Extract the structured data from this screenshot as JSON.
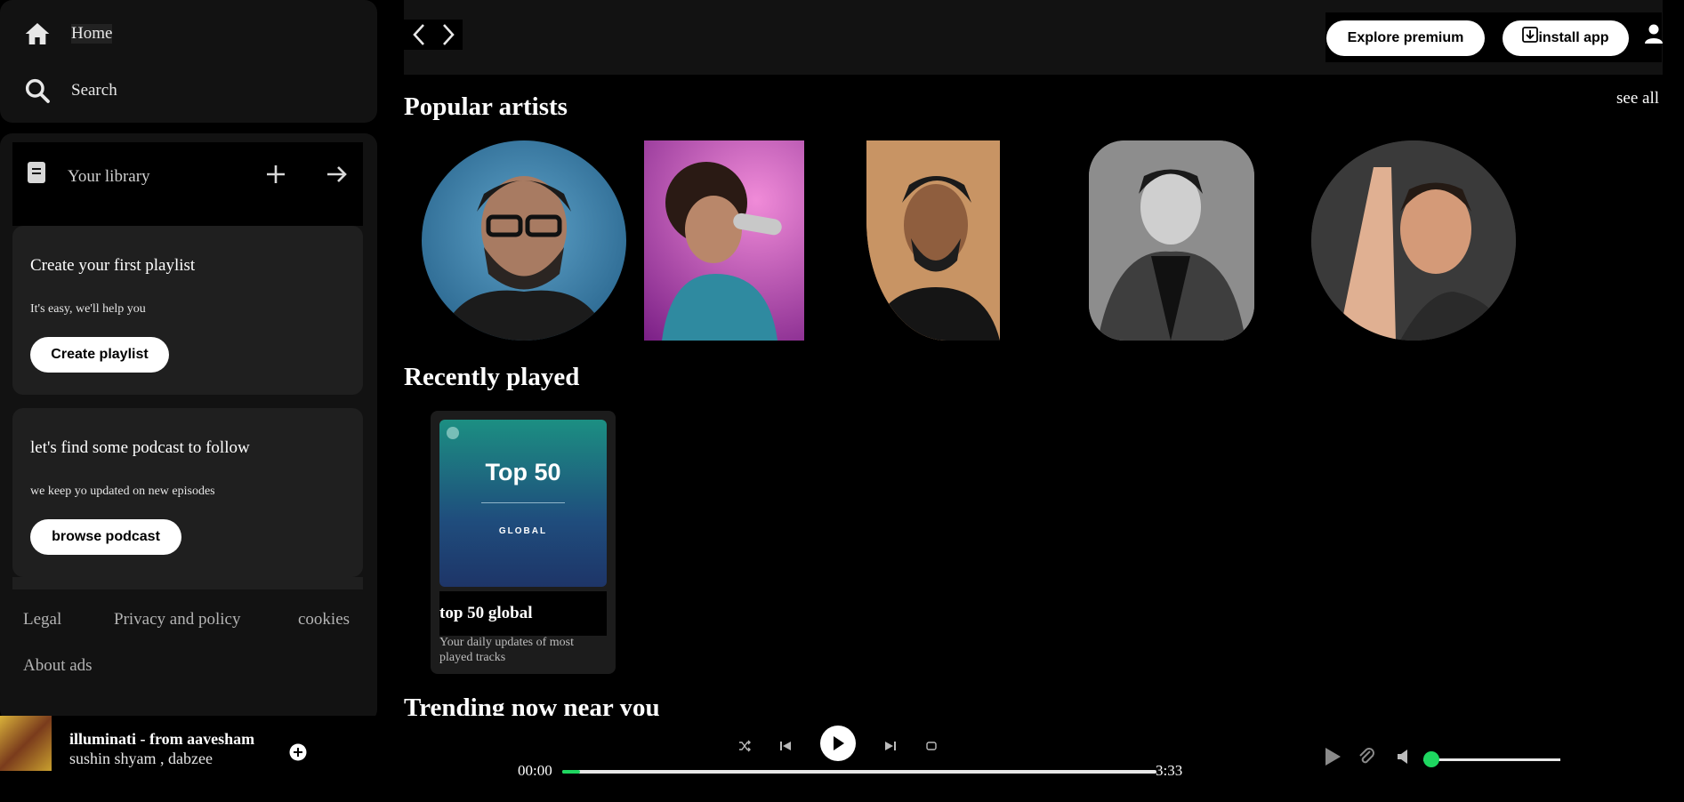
{
  "nav": {
    "home_label": "Home",
    "search_label": "Search"
  },
  "library": {
    "title": "Your library",
    "playlist_card": {
      "title": "Create your first playlist",
      "subtitle": "It's easy, we'll help you",
      "button": "Create playlist"
    },
    "podcast_card": {
      "title": "let's find some podcast to follow",
      "subtitle": "we keep yo updated on new episodes",
      "button": "browse podcast"
    }
  },
  "footer_links": {
    "legal": "Legal",
    "privacy": "Privacy and policy",
    "cookies": "cookies",
    "about_ads": "About ads"
  },
  "topbar": {
    "explore_premium": "Explore premium",
    "install_app": "install app"
  },
  "popular_artists": {
    "title": "Popular artists",
    "see_all": "see all"
  },
  "recently_played": {
    "title": "Recently played",
    "item": {
      "cover_title": "Top 50",
      "cover_subtitle": "GLOBAL",
      "name": "top 50 global",
      "description": "Your daily updates of most played tracks"
    }
  },
  "trending": {
    "title": "Trending now near you"
  },
  "now_playing": {
    "track": "illuminati - from aavesham",
    "artists": "sushin shyam , dabzee",
    "elapsed": "00:00",
    "duration": "3:33",
    "progress": 0.03,
    "volume": 0.0
  },
  "colors": {
    "accent_green": "#1ed760",
    "panel": "#121212",
    "card": "#1f1f1f"
  },
  "icons": [
    "home-icon",
    "search-icon",
    "library-icon",
    "plus-icon",
    "arrow-right-icon",
    "chevron-left-icon",
    "chevron-right-icon",
    "user-icon",
    "download-icon",
    "shuffle-icon",
    "previous-icon",
    "play-icon",
    "next-icon",
    "repeat-icon",
    "add-circle-icon",
    "now-playing-view-icon",
    "connect-device-icon",
    "volume-icon"
  ]
}
